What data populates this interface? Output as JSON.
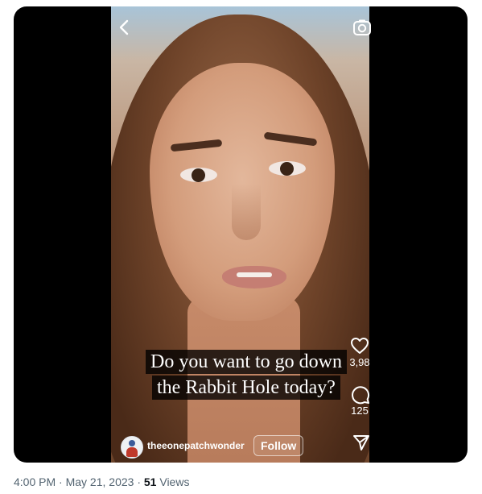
{
  "video": {
    "caption_line1": "Do you want to go down",
    "caption_line2": "the Rabbit Hole today?",
    "username": "theeonepatchwonder",
    "follow_label": "Follow",
    "likes": "3,98",
    "comments": "125"
  },
  "tweet_meta": {
    "time": "4:00 PM",
    "date": "May 21, 2023",
    "separator": "·",
    "views_count": "51",
    "views_label": "Views"
  },
  "icons": {
    "back": "chevron-left-icon",
    "camera": "camera-icon",
    "like": "heart-icon",
    "comment": "comment-icon",
    "share": "send-icon"
  }
}
